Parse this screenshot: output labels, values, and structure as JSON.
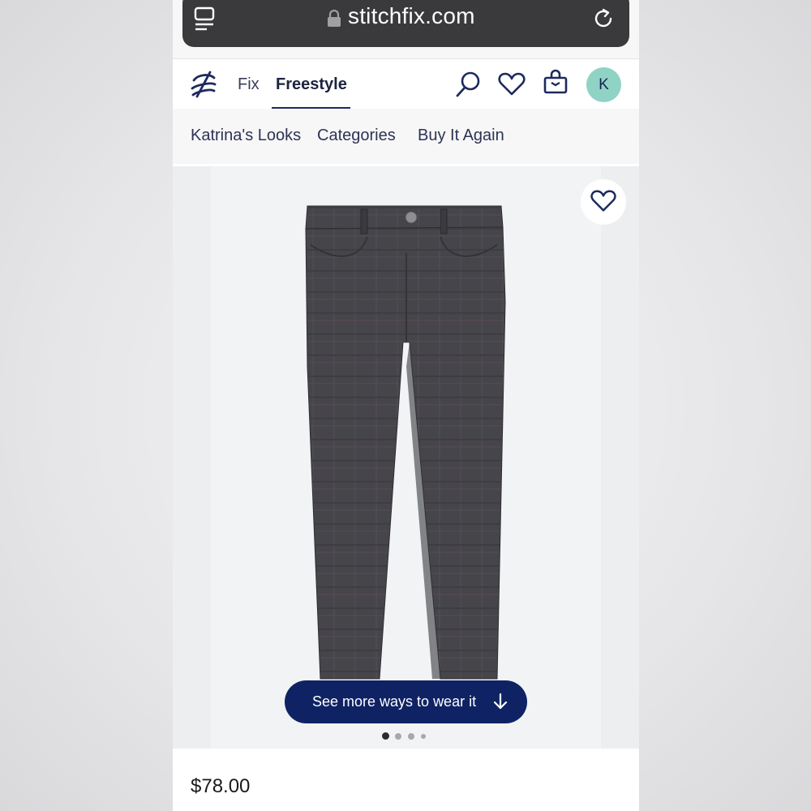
{
  "browser": {
    "url": "stitchfix.com"
  },
  "header": {
    "nav": [
      {
        "label": "Fix"
      },
      {
        "label": "Freestyle"
      }
    ],
    "avatar_initial": "K"
  },
  "subnav": {
    "items": [
      {
        "label": "Katrina's Looks"
      },
      {
        "label": "Categories"
      },
      {
        "label": "Buy It Again"
      }
    ]
  },
  "product": {
    "cta_label": "See more ways to wear it",
    "image_count": 4,
    "active_image_index": 0,
    "price": "$78.00"
  },
  "colors": {
    "brand_navy": "#0f2364",
    "avatar_bg": "#8fd3c5",
    "urlbar_bg": "#3a3a3c"
  },
  "icons": [
    "tabs-icon",
    "lock-icon",
    "reload-icon",
    "stitchfix-logo-icon",
    "search-icon",
    "heart-icon",
    "shopping-bag-icon",
    "arrow-down-icon"
  ]
}
